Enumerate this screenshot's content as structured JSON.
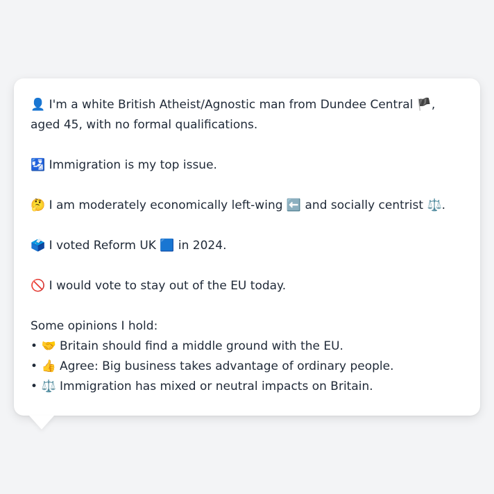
{
  "profile": {
    "identity": {
      "icon": "👤",
      "text_before": " I'm a white British Atheist/Agnostic man from Dundee Central ",
      "flag": "🏴",
      "text_after": ", aged 45, with no formal qualifications."
    },
    "top_issue": {
      "icon": "🛂",
      "text": " Immigration is my top issue."
    },
    "politics": {
      "icon": "🤔",
      "text_before": " I am moderately economically left-wing ",
      "left_icon": "⬅️",
      "text_middle": " and socially centrist ",
      "scale_icon": "⚖️",
      "text_after": "."
    },
    "vote": {
      "icon": "🗳️",
      "text_before": " I voted Reform UK ",
      "party_icon": "🟦",
      "text_after": " in 2024."
    },
    "eu": {
      "icon": "🚫",
      "text": " I would vote to stay out of the EU today."
    },
    "opinions_heading": "Some opinions I hold:",
    "opinions": [
      {
        "bullet": "• ",
        "icon": "🤝",
        "text": " Britain should find a middle ground with the EU."
      },
      {
        "bullet": "• ",
        "icon": "👍",
        "text": " Agree: Big business takes advantage of ordinary people."
      },
      {
        "bullet": "• ",
        "icon": "⚖️",
        "text": " Immigration has mixed or neutral impacts on Britain."
      }
    ]
  }
}
